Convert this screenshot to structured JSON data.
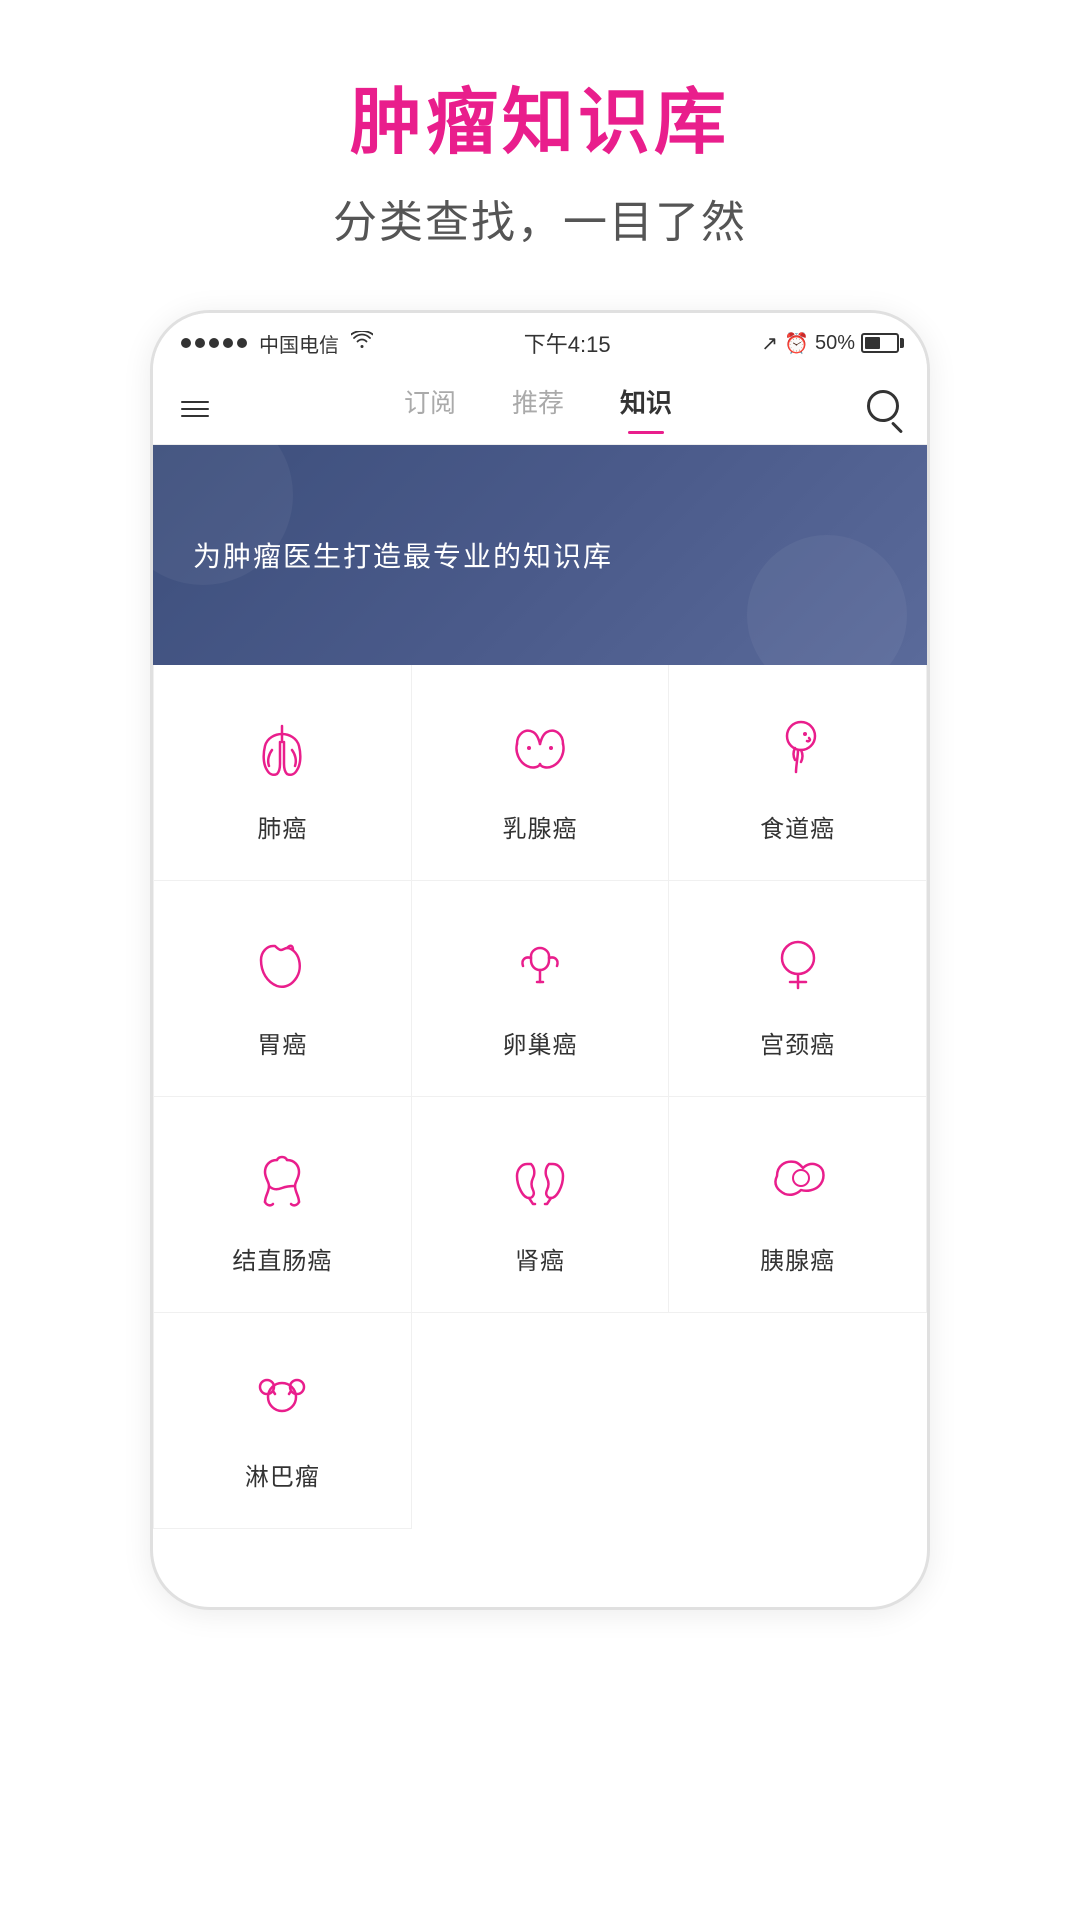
{
  "page": {
    "title": "肿瘤知识库",
    "subtitle": "分类查找，一目了然"
  },
  "status_bar": {
    "signal": "●●●●●",
    "carrier": "中国电信",
    "wifi": "WiFi",
    "time": "下午4:15",
    "location": "↗",
    "alarm": "⏰",
    "battery_percent": "50%"
  },
  "nav": {
    "tab1": "订阅",
    "tab2": "推荐",
    "tab3": "知识"
  },
  "banner": {
    "text": "为肿瘤医生打造最专业的知识库"
  },
  "grid": {
    "items": [
      {
        "id": "lung",
        "label": "肺癌",
        "icon": "lung"
      },
      {
        "id": "breast",
        "label": "乳腺癌",
        "icon": "breast"
      },
      {
        "id": "esophagus",
        "label": "食道癌",
        "icon": "esophagus"
      },
      {
        "id": "stomach",
        "label": "胃癌",
        "icon": "stomach"
      },
      {
        "id": "ovary",
        "label": "卵巢癌",
        "icon": "ovary"
      },
      {
        "id": "cervix",
        "label": "宫颈癌",
        "icon": "cervix"
      },
      {
        "id": "colon",
        "label": "结直肠癌",
        "icon": "colon"
      },
      {
        "id": "kidney",
        "label": "肾癌",
        "icon": "kidney"
      },
      {
        "id": "pancreas",
        "label": "胰腺癌",
        "icon": "pancreas"
      },
      {
        "id": "lymph",
        "label": "淋巴瘤",
        "icon": "lymph"
      }
    ]
  },
  "colors": {
    "primary": "#e91e8c",
    "banner_bg": "#3d4f7c"
  }
}
